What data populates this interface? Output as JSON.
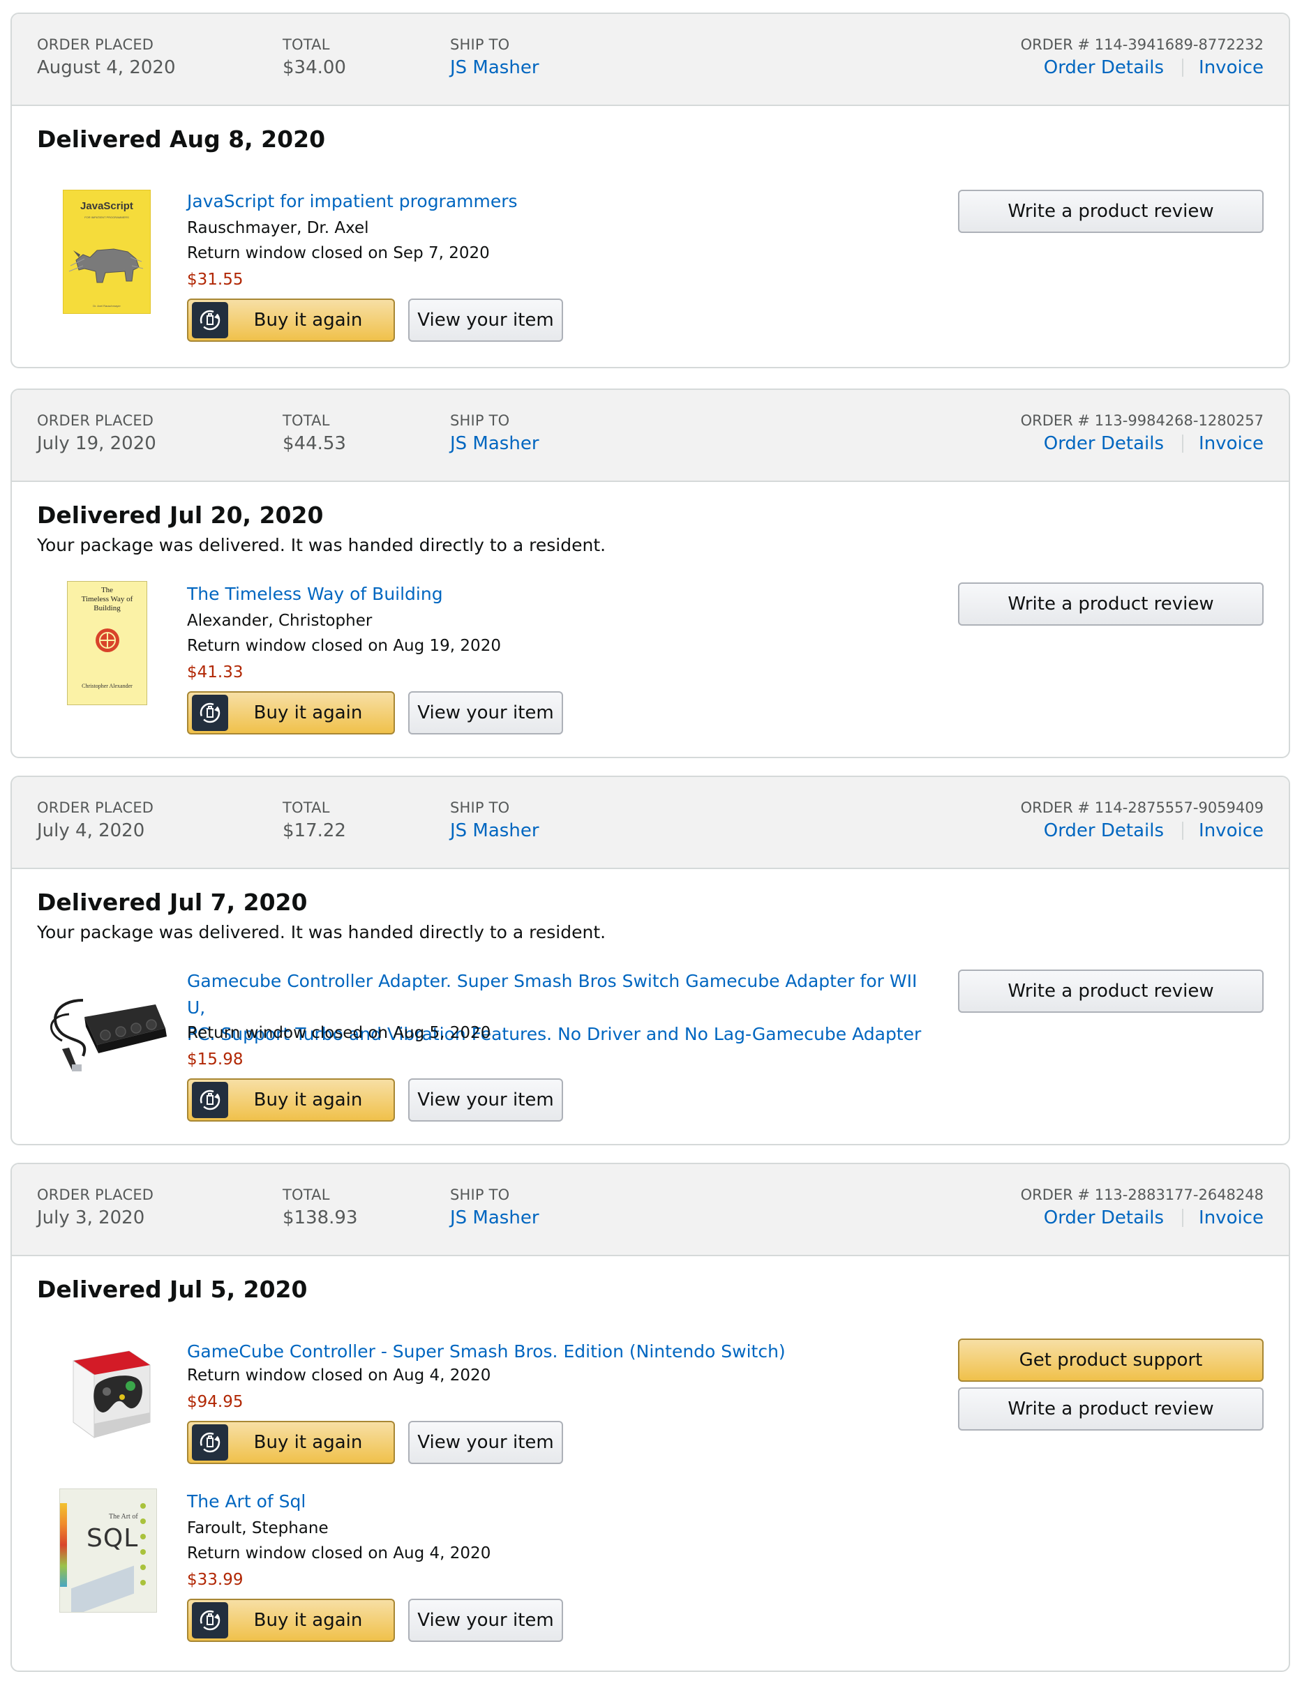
{
  "labels": {
    "order_placed": "ORDER PLACED",
    "total": "TOTAL",
    "ship_to": "SHIP TO",
    "order_details": "Order Details",
    "invoice": "Invoice",
    "buy_again": "Buy it again",
    "view_item": "View your item",
    "write_review": "Write a product review",
    "get_support": "Get product support"
  },
  "colors": {
    "link": "#0066c0",
    "price": "#b12704",
    "primary_button": "#f0c14b",
    "header_bg": "#f2f2f2"
  },
  "orders": [
    {
      "placed": "August 4, 2020",
      "total": "$34.00",
      "ship_to": "JS Masher",
      "order_number": "ORDER # 114-3941689-8772232",
      "delivered": "Delivered Aug 8, 2020",
      "delivery_note": "",
      "items": [
        {
          "title": "JavaScript for impatient programmers",
          "author": "Rauschmayer, Dr. Axel",
          "return_window": "Return window closed on Sep 7, 2020",
          "price": "$31.55",
          "thumb": "javascript-book-cover",
          "cover_title": "JavaScript",
          "cover_subtitle": "FOR IMPATIENT PROGRAMMERS",
          "cover_author": "Dr. Axel Rauschmayer"
        }
      ]
    },
    {
      "placed": "July 19, 2020",
      "total": "$44.53",
      "ship_to": "JS Masher",
      "order_number": "ORDER # 113-9984268-1280257",
      "delivered": "Delivered Jul 20, 2020",
      "delivery_note": "Your package was delivered. It was handed directly to a resident.",
      "items": [
        {
          "title": "The Timeless Way of Building",
          "author": "Alexander, Christopher",
          "return_window": "Return window closed on Aug 19, 2020",
          "price": "$41.33",
          "thumb": "timeless-way-book-cover",
          "cover_title_1": "The",
          "cover_title_2": "Timeless Way of",
          "cover_title_3": "Building",
          "cover_author": "Christopher Alexander"
        }
      ]
    },
    {
      "placed": "July 4, 2020",
      "total": "$17.22",
      "ship_to": "JS Masher",
      "order_number": "ORDER # 114-2875557-9059409",
      "delivered": "Delivered Jul 7, 2020",
      "delivery_note": "Your package was delivered. It was handed directly to a resident.",
      "items": [
        {
          "title_line1": "Gamecube Controller Adapter. Super Smash Bros Switch Gamecube Adapter for WII U,",
          "title_line2": "PC. Support Turbo and Vibration Features. No Driver and No Lag-Gamecube Adapter",
          "return_window": "Return window closed on Aug 5, 2020",
          "price": "$15.98",
          "thumb": "gamecube-adapter-image"
        }
      ]
    },
    {
      "placed": "July 3, 2020",
      "total": "$138.93",
      "ship_to": "JS Masher",
      "order_number": "ORDER # 113-2883177-2648248",
      "delivered": "Delivered Jul 5, 2020",
      "delivery_note": "",
      "items": [
        {
          "title": "GameCube Controller - Super Smash Bros. Edition (Nintendo Switch)",
          "return_window": "Return window closed on Aug 4, 2020",
          "price": "$94.95",
          "thumb": "gamecube-controller-box-image"
        },
        {
          "title": "The Art of Sql",
          "author": "Faroult, Stephane",
          "return_window": "Return window closed on Aug 4, 2020",
          "price": "$33.99",
          "thumb": "art-of-sql-book-cover",
          "cover_title_small": "The Art of",
          "cover_title_big": "SQL"
        }
      ]
    }
  ]
}
